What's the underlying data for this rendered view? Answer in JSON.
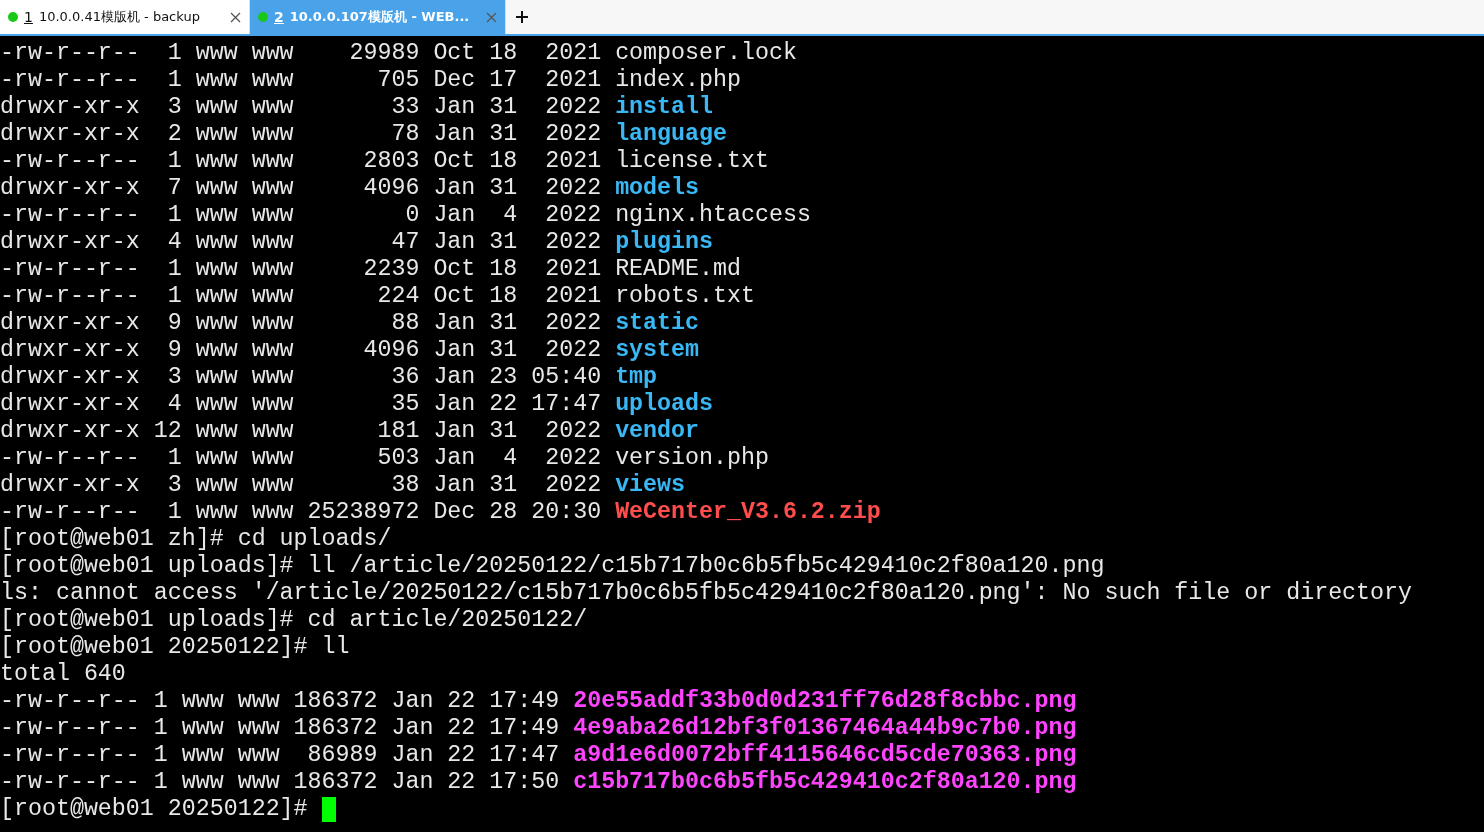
{
  "tabs": [
    {
      "number": "1",
      "title": "10.0.0.41模版机 - backup",
      "selected": false
    },
    {
      "number": "2",
      "title": "10.0.0.107模版机 - WEB...",
      "selected": true
    }
  ],
  "terminal": {
    "cursor": true,
    "lines": [
      {
        "text": "-rw-r--r--  1 www www    29989 Oct 18  2021 composer.lock"
      },
      {
        "text": "-rw-r--r--  1 www www      705 Dec 17  2021 index.php"
      },
      {
        "text": "drwxr-xr-x  3 www www       33 Jan 31  2022 ",
        "file": "install",
        "kind": "directory"
      },
      {
        "text": "drwxr-xr-x  2 www www       78 Jan 31  2022 ",
        "file": "language",
        "kind": "directory"
      },
      {
        "text": "-rw-r--r--  1 www www     2803 Oct 18  2021 license.txt"
      },
      {
        "text": "drwxr-xr-x  7 www www     4096 Jan 31  2022 ",
        "file": "models",
        "kind": "directory"
      },
      {
        "text": "-rw-r--r--  1 www www        0 Jan  4  2022 nginx.htaccess"
      },
      {
        "text": "drwxr-xr-x  4 www www       47 Jan 31  2022 ",
        "file": "plugins",
        "kind": "directory"
      },
      {
        "text": "-rw-r--r--  1 www www     2239 Oct 18  2021 README.md"
      },
      {
        "text": "-rw-r--r--  1 www www      224 Oct 18  2021 robots.txt"
      },
      {
        "text": "drwxr-xr-x  9 www www       88 Jan 31  2022 ",
        "file": "static",
        "kind": "directory"
      },
      {
        "text": "drwxr-xr-x  9 www www     4096 Jan 31  2022 ",
        "file": "system",
        "kind": "directory"
      },
      {
        "text": "drwxr-xr-x  3 www www       36 Jan 23 05:40 ",
        "file": "tmp",
        "kind": "directory"
      },
      {
        "text": "drwxr-xr-x  4 www www       35 Jan 22 17:47 ",
        "file": "uploads",
        "kind": "directory"
      },
      {
        "text": "drwxr-xr-x 12 www www      181 Jan 31  2022 ",
        "file": "vendor",
        "kind": "directory"
      },
      {
        "text": "-rw-r--r--  1 www www      503 Jan  4  2022 version.php"
      },
      {
        "text": "drwxr-xr-x  3 www www       38 Jan 31  2022 ",
        "file": "views",
        "kind": "directory"
      },
      {
        "text": "-rw-r--r--  1 www www 25238972 Dec 28 20:30 ",
        "file": "WeCenter_V3.6.2.zip",
        "kind": "archive"
      },
      {
        "text": "[root@web01 zh]# cd uploads/"
      },
      {
        "text": "[root@web01 uploads]# ll /article/20250122/c15b717b0c6b5fb5c429410c2f80a120.png"
      },
      {
        "text": "ls: cannot access '/article/20250122/c15b717b0c6b5fb5c429410c2f80a120.png': No such file or directory"
      },
      {
        "text": "[root@web01 uploads]# cd article/20250122/"
      },
      {
        "text": "[root@web01 20250122]# ll"
      },
      {
        "text": "total 640"
      },
      {
        "text": "-rw-r--r-- 1 www www 186372 Jan 22 17:49 ",
        "file": "20e55addf33b0d0d231ff76d28f8cbbc.png",
        "kind": "image"
      },
      {
        "text": "-rw-r--r-- 1 www www 186372 Jan 22 17:49 ",
        "file": "4e9aba26d12bf3f01367464a44b9c7b0.png",
        "kind": "image"
      },
      {
        "text": "-rw-r--r-- 1 www www  86989 Jan 22 17:47 ",
        "file": "a9d1e6d0072bff4115646cd5cde70363.png",
        "kind": "image"
      },
      {
        "text": "-rw-r--r-- 1 www www 186372 Jan 22 17:50 ",
        "file": "c15b717b0c6b5fb5c429410c2f80a120.png",
        "kind": "image"
      },
      {
        "text": "[root@web01 20250122]# "
      }
    ]
  }
}
